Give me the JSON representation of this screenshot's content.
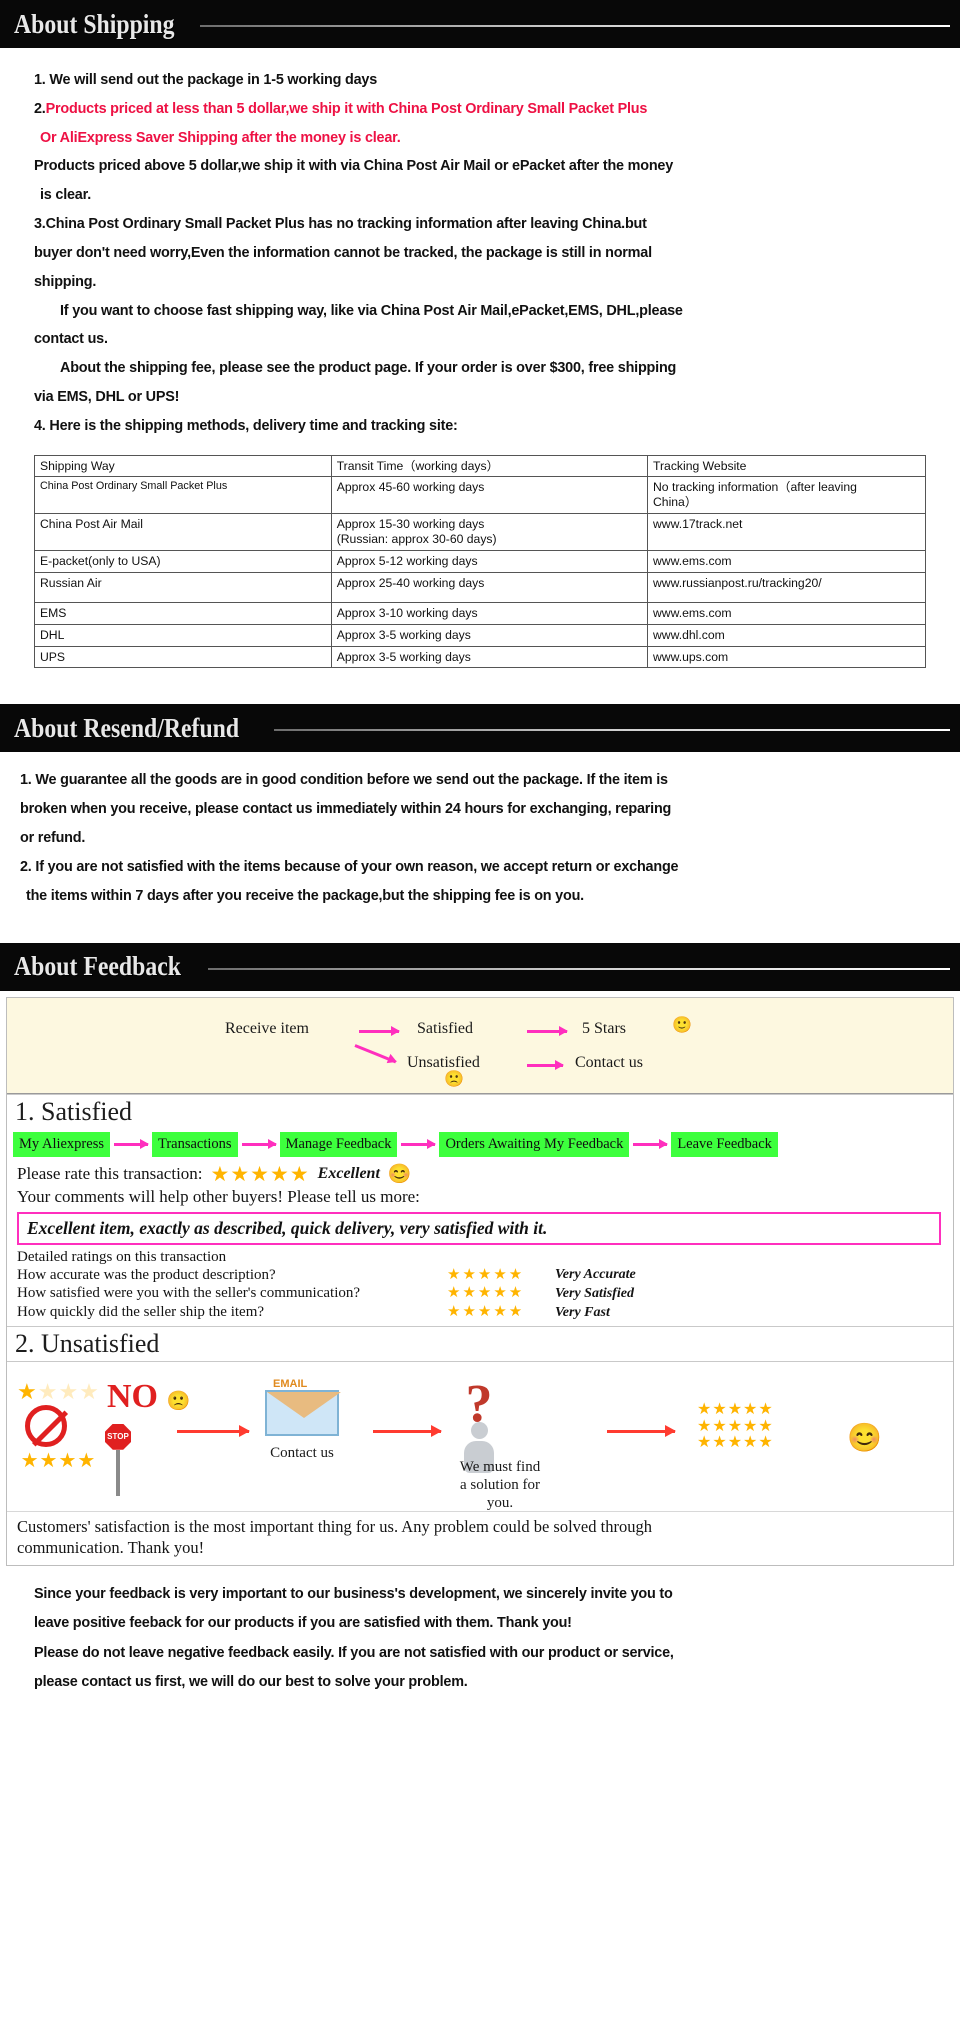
{
  "sections": {
    "shipping": {
      "title": "About Shipping",
      "lines": {
        "l1": "1. We will send out the package in 1-5 working days",
        "l2_num": "2.",
        "l2_red_a": "Products priced at less than 5 dollar,we ship it with China Post Ordinary Small Packet Plus",
        "l2_red_b": "Or AliExpress Saver Shipping after the money is clear.",
        "l3a": "Products priced above 5 dollar,we ship it with via China Post Air Mail or ePacket after the money",
        "l3b": "is clear.",
        "l4a": "3.China Post Ordinary Small Packet Plus has no tracking information after leaving China.but",
        "l4b": "buyer don't need worry,Even the information cannot be tracked, the package is still in normal",
        "l4c": "shipping.",
        "l5a": "If you want to choose fast shipping way, like via China Post Air Mail,ePacket,EMS, DHL,please",
        "l5b": "contact us.",
        "l6a": "About the shipping fee, please see the product page. If your order is over $300, free shipping",
        "l6b": "via EMS, DHL or UPS!",
        "l7": "4. Here is the shipping methods, delivery time and tracking site:"
      },
      "table": {
        "headers": [
          "Shipping Way",
          "Transit Time（working days）",
          "Tracking Website"
        ],
        "rows": [
          {
            "way": "China Post Ordinary Small Packet Plus",
            "time": "Approx 45-60 working days",
            "site_l1": "No tracking information（after leaving",
            "site_l2": "China）"
          },
          {
            "way": "China Post Air Mail",
            "time_l1": "Approx 15-30 working days",
            "time_l2": "(Russian: approx 30-60 days)",
            "site": "www.17track.net"
          },
          {
            "way": "E-packet(only to USA)",
            "time": "Approx 5-12 working days",
            "site": "www.ems.com"
          },
          {
            "way": "Russian Air",
            "time": "Approx 25-40 working days",
            "site": "www.russianpost.ru/tracking20/"
          },
          {
            "way": "EMS",
            "time": "Approx 3-10 working days",
            "site": "www.ems.com"
          },
          {
            "way": "DHL",
            "time": "Approx 3-5 working days",
            "site": "www.dhl.com"
          },
          {
            "way": "UPS",
            "time": "Approx 3-5 working days",
            "site": "www.ups.com"
          }
        ]
      }
    },
    "refund": {
      "title": "About Resend/Refund",
      "lines": {
        "l1a": "1. We guarantee all the goods are in good condition before we send out the package. If the item is",
        "l1b": "broken when you receive, please contact us immediately within 24 hours for exchanging, reparing",
        "l1c": "or refund.",
        "l2a": "2. If you are not satisfied with the items because of your own reason, we accept return or exchange",
        "l2b": "the items within 7 days after you receive the package,but the shipping fee is on you."
      }
    },
    "feedback": {
      "title": "About Feedback",
      "flow": {
        "receive": "Receive item",
        "satisfied": "Satisfied",
        "five_stars": "5 Stars",
        "unsatisfied": "Unsatisfied",
        "contact_us": "Contact us",
        "happy_face": "🙂",
        "sad_face": "🙁"
      },
      "satisfied": {
        "heading": "1. Satisfied",
        "steps": [
          "My Aliexpress",
          "Transactions",
          "Manage Feedback",
          "Orders Awaiting My Feedback",
          "Leave Feedback"
        ],
        "rate_prompt": "Please rate this transaction:",
        "rate_stars": "★★★★★",
        "rate_word": "Excellent",
        "rate_face": "😊",
        "comments_prompt": "Your comments will help other buyers! Please tell us more:",
        "comment_text": "Excellent item, exactly as described, quick delivery, very satisfied with it.",
        "detail_head": "Detailed ratings on this transaction",
        "details": [
          {
            "question": "How accurate was the product description?",
            "stars": "★★★★★",
            "value": "Very Accurate"
          },
          {
            "question": "How satisfied were you with the seller's communication?",
            "stars": "★★★★★",
            "value": "Very Satisfied"
          },
          {
            "question": "How quickly did the seller ship the item?",
            "stars": "★★★★★",
            "value": "Very Fast"
          }
        ]
      },
      "unsatisfied": {
        "heading": "2. Unsatisfied",
        "no_text": "NO",
        "stop_text": "STOP",
        "email_text": "EMAIL",
        "contact_caption": "Contact us",
        "solution_caption_l1": "We must find",
        "solution_caption_l2": "a solution for",
        "solution_caption_l3": "you.",
        "star_rows": [
          "★★★★★",
          "★★★★★",
          "★★★★★"
        ],
        "face": "😊",
        "closing_l1": "Customers' satisfaction is the most important thing for us. Any problem could be solved through",
        "closing_l2": "communication. Thank you!"
      },
      "footer": {
        "l1a": "Since your feedback is very important to our business's development, we sincerely invite you to",
        "l1b": "leave positive feeback for our products if you are satisfied with them. Thank you!",
        "l2a": "Please do not leave negative feedback easily. If you are not satisfied with our product or service,",
        "l2b": "please contact us first, we will do our best to solve your problem."
      }
    }
  },
  "colors": {
    "banner_bg": "#080808",
    "red_text": "#ee1144",
    "pink_arrow": "#ff2fbe",
    "green_chip": "#3dff3d",
    "star_gold": "#ffb400",
    "cream_panel": "#fdf8e0"
  }
}
